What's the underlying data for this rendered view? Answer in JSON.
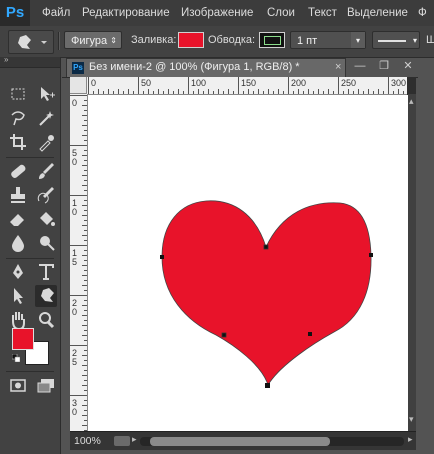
{
  "app": {
    "logo": "Ps",
    "menu": [
      "Файл",
      "Редактирование",
      "Изображение",
      "Слои",
      "Текст",
      "Выделение",
      "Ф"
    ]
  },
  "options_bar": {
    "mode": "Фигура",
    "fill_label": "Заливка:",
    "fill_color": "#e8132a",
    "stroke_label": "Обводка:",
    "stroke_width": "1 пт",
    "tail_label": "Ш"
  },
  "document": {
    "tab_title": "Без имени-2 @ 100% (Фигура 1, RGB/8) *",
    "tab_close": "×",
    "window_buttons": [
      "—",
      "❐",
      "✕"
    ],
    "ruler_h_labels": [
      "0",
      "50",
      "100",
      "150",
      "200",
      "250",
      "300"
    ],
    "ruler_v_labels": [
      "0",
      "5",
      "1",
      "1",
      "2",
      "2",
      "3",
      "3"
    ],
    "ruler_v_labels2": [
      "",
      "0",
      "0",
      "5",
      "0",
      "5",
      "0",
      "5"
    ],
    "zoom": "100%"
  },
  "colors": {
    "foreground": "#e8132a",
    "background": "#ffffff",
    "heart_fill": "#e8132a",
    "ps_blue": "#31a8ff"
  },
  "tools": {
    "left": [
      "marquee-icon",
      "lasso-icon",
      "crop-icon",
      "healing-icon",
      "stamp-icon",
      "eraser-icon",
      "blur-icon",
      "pen-icon",
      "path-select-icon",
      "hand-icon"
    ],
    "right": [
      "move-icon",
      "magic-wand-icon",
      "eyedropper-icon",
      "brush-icon",
      "history-brush-icon",
      "bucket-icon",
      "dodge-icon",
      "type-icon",
      "custom-shape-icon",
      "zoom-icon"
    ]
  }
}
